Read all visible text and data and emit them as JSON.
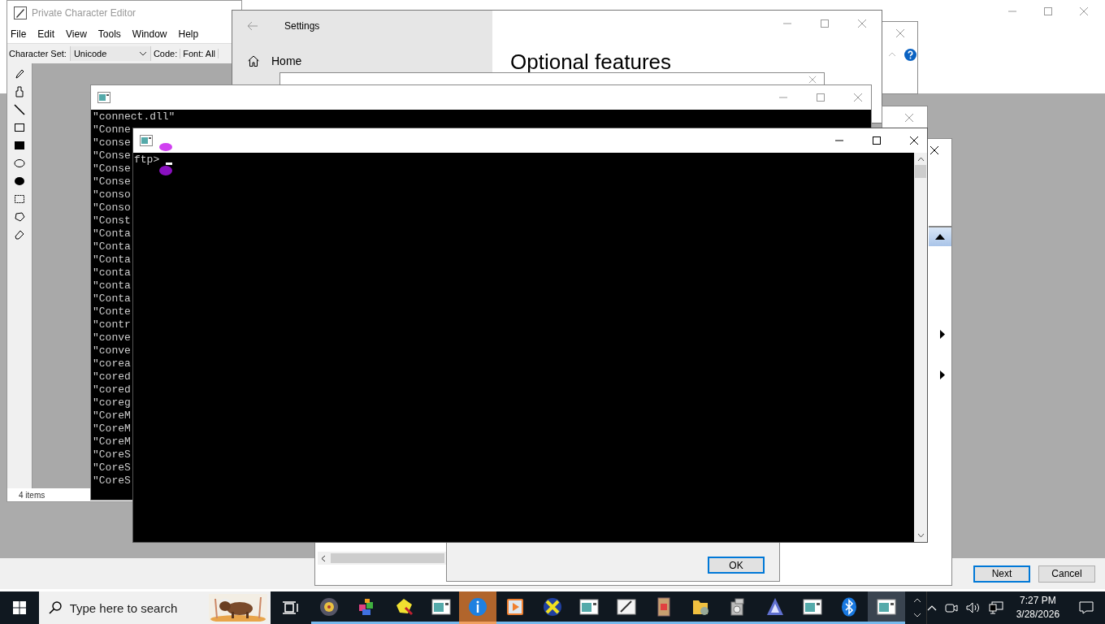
{
  "private_character_editor": {
    "title": "Private Character Editor",
    "menu": [
      "File",
      "Edit",
      "View",
      "Tools",
      "Window",
      "Help"
    ],
    "charset_label": "Character Set:",
    "charset_value": "Unicode",
    "code_label": "Code:",
    "font_label": "Font: All",
    "status": "4 items"
  },
  "settings_window": {
    "title": "Settings",
    "home": "Home",
    "heading": "Optional features"
  },
  "console_window": {
    "lines": [
      "\"connect.dll\"",
      "\"Conne",
      "\"conse",
      "\"Conse",
      "\"Conse",
      "\"Conse",
      "\"conso",
      "\"Conso",
      "\"Const",
      "\"Conta",
      "\"Conta",
      "\"Conta",
      "\"conta",
      "\"conta",
      "\"Conta",
      "\"Conte",
      "\"contr",
      "\"conve",
      "\"conve",
      "\"corea",
      "\"cored",
      "\"cored",
      "\"coreg",
      "\"CoreM",
      "\"CoreM",
      "\"CoreM",
      "\"CoreS",
      "\"CoreS",
      "\"CoreS"
    ]
  },
  "ftp_window": {
    "prompt": "ftp>"
  },
  "ok_dialog": {
    "ok": "OK"
  },
  "wizard": {
    "next": "Next",
    "cancel": "Cancel"
  },
  "taskbar": {
    "search_placeholder": "Type here to search",
    "apps": [
      {
        "kind": "disc",
        "selected": false,
        "flashing": false,
        "running": true
      },
      {
        "kind": "cubes",
        "selected": false,
        "flashing": false,
        "running": true
      },
      {
        "kind": "hand",
        "selected": false,
        "flashing": false,
        "running": true
      },
      {
        "kind": "console",
        "selected": false,
        "flashing": false,
        "running": true
      },
      {
        "kind": "info",
        "selected": false,
        "flashing": true,
        "running": true
      },
      {
        "kind": "play",
        "selected": false,
        "flashing": false,
        "running": true
      },
      {
        "kind": "xmark",
        "selected": false,
        "flashing": false,
        "running": true
      },
      {
        "kind": "console",
        "selected": false,
        "flashing": false,
        "running": true
      },
      {
        "kind": "pen",
        "selected": false,
        "flashing": false,
        "running": true
      },
      {
        "kind": "book",
        "selected": false,
        "flashing": false,
        "running": true
      },
      {
        "kind": "folder",
        "selected": false,
        "flashing": false,
        "running": true
      },
      {
        "kind": "media",
        "selected": false,
        "flashing": false,
        "running": true
      },
      {
        "kind": "triangle",
        "selected": false,
        "flashing": false,
        "running": true
      },
      {
        "kind": "console",
        "selected": false,
        "flashing": false,
        "running": true
      },
      {
        "kind": "bluetooth",
        "selected": false,
        "flashing": false,
        "running": true
      },
      {
        "kind": "console",
        "selected": true,
        "flashing": false,
        "running": true
      }
    ],
    "time": "7:27 PM",
    "date": "3/28/2026"
  }
}
